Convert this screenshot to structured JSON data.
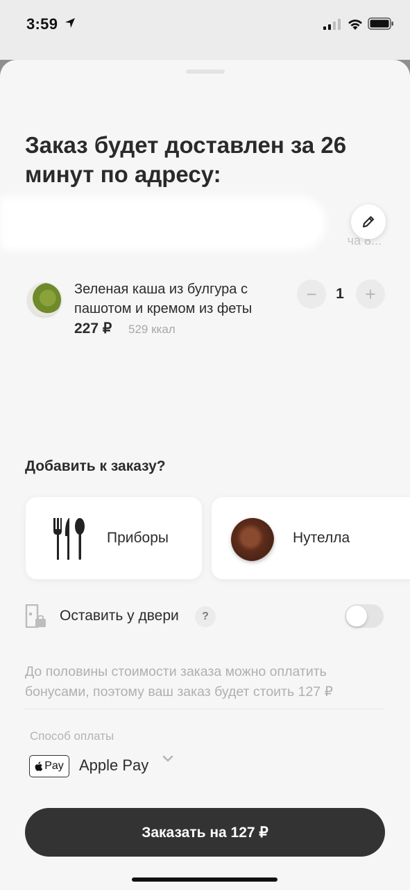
{
  "status_bar": {
    "time": "3:59",
    "icons": [
      "location-arrow-icon",
      "cellular-signal-icon",
      "wifi-icon",
      "battery-icon"
    ]
  },
  "sheet": {
    "title": "Заказ будет доставлен за 26 минут по адресу:",
    "address_fragment": "ча 8...",
    "edit_icon": "pencil-icon"
  },
  "cart_item": {
    "name": "Зеленая каша из булгура с пашотом и кремом из феты",
    "price": "227 ₽",
    "kcal": "529 ккал",
    "quantity": "1",
    "minus_label": "−",
    "plus_label": "+"
  },
  "add_to_order": {
    "title": "Добавить к заказу?",
    "items": [
      {
        "label": "Приборы",
        "icon": "cutlery-icon"
      },
      {
        "label": "Нутелла",
        "icon": "nutella-image"
      }
    ]
  },
  "leave_at_door": {
    "label": "Оставить у двери",
    "help": "?",
    "enabled": false
  },
  "bonus_note": "До половины стоимости заказа можно оплатить бонусами, поэтому ваш заказ будет стоить 127 ₽",
  "payment": {
    "label": "Способ оплаты",
    "badge_text": "Pay",
    "method": "Apple Pay"
  },
  "order_button": "Заказать на 127 ₽",
  "colors": {
    "primary_button": "#333333",
    "sheet_background": "#f6f6f6",
    "muted_text": "#b0b0b0"
  }
}
